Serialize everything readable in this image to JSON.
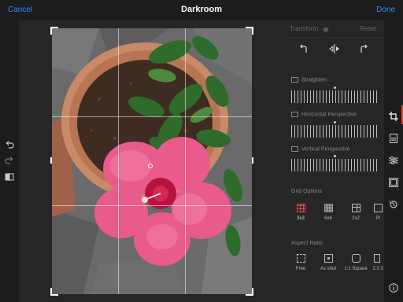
{
  "topbar": {
    "cancel_label": "Cancel",
    "title": "Darkroom",
    "done_label": "Done"
  },
  "left_tools": {
    "icons": [
      "undo-icon",
      "redo-icon",
      "compare-icon"
    ]
  },
  "panel": {
    "tab_transform": "Transform",
    "eye_icon": "eye-icon",
    "reset_label": "Reset",
    "transform_buttons": [
      "rotate-left-icon",
      "flip-horizontal-icon",
      "rotate-right-icon"
    ],
    "sliders": [
      {
        "label": "Straighten",
        "icon": "straighten-icon"
      },
      {
        "label": "Horizontal Perspective",
        "icon": "horizontal-perspective-icon"
      },
      {
        "label": "Vertical Perspective",
        "icon": "vertical-perspective-icon"
      }
    ],
    "grid_options_title": "Grid Options",
    "grid_options": [
      {
        "label": "3x3",
        "selected": true
      },
      {
        "label": "6x6",
        "selected": false
      },
      {
        "label": "2x2",
        "selected": false
      },
      {
        "label": "Pl",
        "selected": false
      }
    ],
    "aspect_ratio_title": "Aspect Ratio",
    "aspect_ratios": [
      {
        "label": "Free"
      },
      {
        "label": "As shot"
      },
      {
        "label": "1:1 Square"
      },
      {
        "label": "2:3 3"
      }
    ]
  },
  "right_strip": {
    "icons": [
      "crop-icon",
      "filters-icon",
      "adjust-sliders-icon",
      "frame-icon",
      "history-icon",
      "info-icon"
    ],
    "active": "crop-icon"
  },
  "colors": {
    "accent": "#2f8bff",
    "selection": "#e04545",
    "background": "#1a1a1a",
    "panel": "#262626"
  }
}
